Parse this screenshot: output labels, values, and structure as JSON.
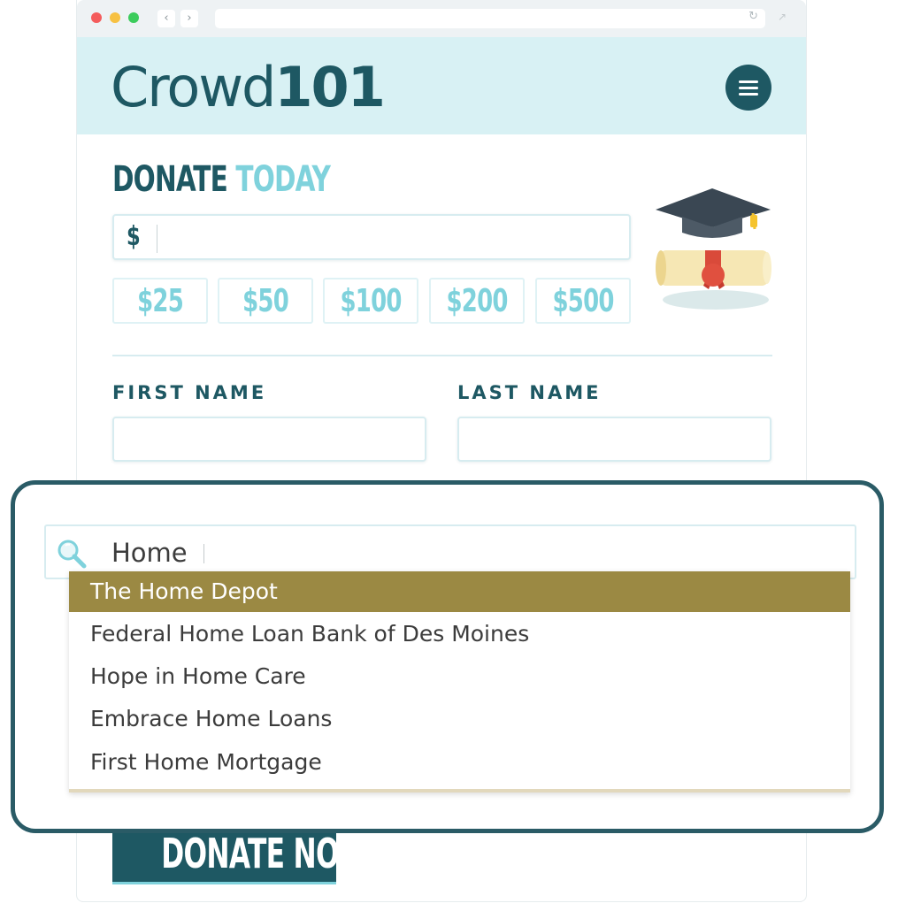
{
  "header": {
    "logo_light": "Crowd",
    "logo_bold": "101"
  },
  "donate": {
    "title_dark": "DONATE",
    "title_light": "TODAY",
    "currency_symbol": "$",
    "amount_value": "",
    "presets": [
      "$25",
      "$50",
      "$100",
      "$200",
      "$500"
    ]
  },
  "form": {
    "first_name_label": "FIRST NAME",
    "last_name_label": "LAST NAME",
    "first_name_value": "",
    "last_name_value": ""
  },
  "employer_search": {
    "query": "Home",
    "results": [
      "The Home Depot",
      "Federal Home Loan Bank of Des Moines",
      "Hope in Home Care",
      "Embrace Home Loans",
      "First Home Mortgage"
    ],
    "highlighted_index": 0
  },
  "submit": {
    "label": "DONATE NOW"
  },
  "colors": {
    "brand_dark": "#1e5863",
    "brand_light": "#7fd2dc",
    "header_bg": "#d8f1f4",
    "highlight": "#9b8943"
  },
  "icons": [
    "back-arrow-icon",
    "forward-arrow-icon",
    "reload-icon",
    "expand-icon",
    "hamburger-menu-icon",
    "graduation-cap-icon",
    "search-icon"
  ]
}
